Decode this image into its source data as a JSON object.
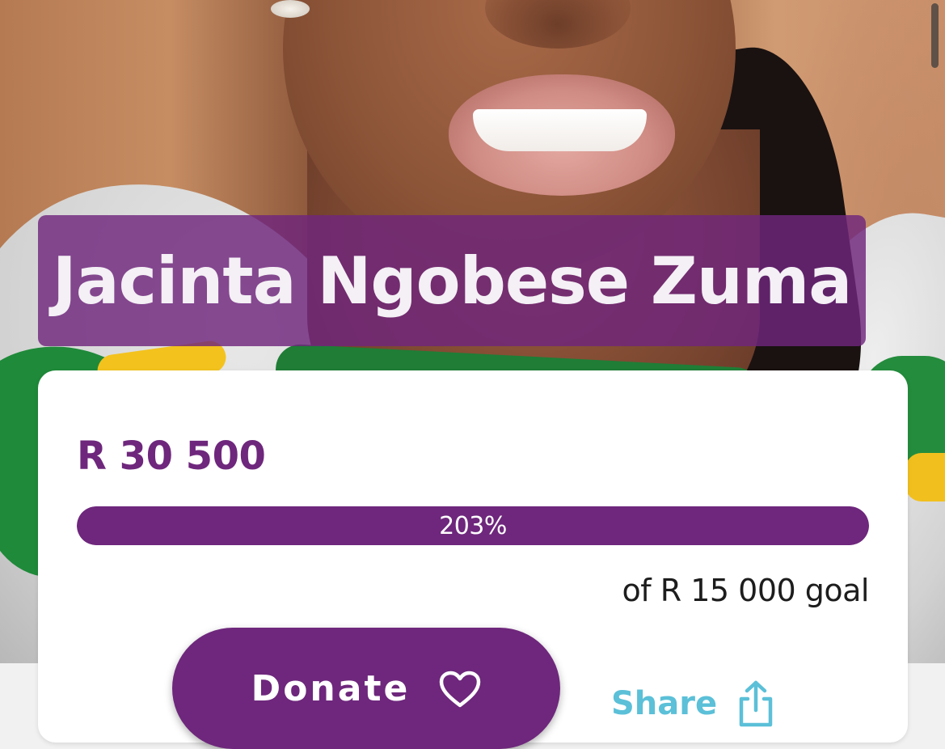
{
  "campaign": {
    "name": "Jacinta Ngobese Zuma",
    "raised": "R 30 500",
    "progress_percent": 203,
    "progress_label": "203%",
    "goal_text": "of R 15 000 goal"
  },
  "actions": {
    "donate_label": "Donate",
    "donate_icon": "heart-icon",
    "share_label": "Share",
    "share_icon": "share-upload-icon"
  },
  "colors": {
    "brand_purple": "#6e277c",
    "share_blue": "#5bc0d8",
    "card_bg": "#ffffff"
  }
}
